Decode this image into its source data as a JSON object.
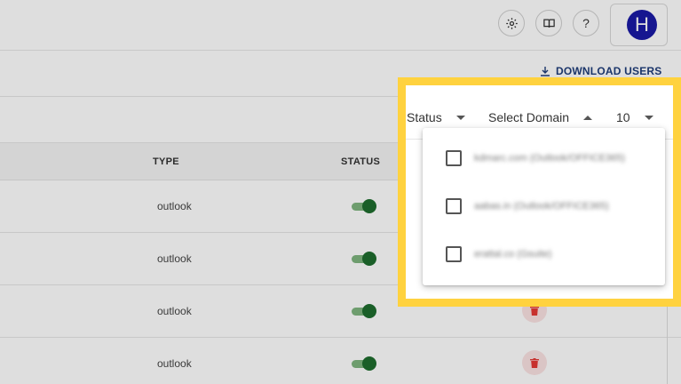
{
  "header": {
    "settings_icon": "gear-icon",
    "docs_icon": "book-icon",
    "help_label": "?",
    "avatar_initial": "H"
  },
  "toolbar": {
    "download_label": "DOWNLOAD USERS",
    "download_icon": "download-icon"
  },
  "filters": {
    "status_label": "Status",
    "domain_label": "Select Domain",
    "page_size": "10"
  },
  "table": {
    "columns": [
      "TYPE",
      "STATUS"
    ],
    "rows": [
      {
        "type": "outlook",
        "status": "on"
      },
      {
        "type": "outlook",
        "status": "on"
      },
      {
        "type": "outlook",
        "status": "on"
      },
      {
        "type": "outlook",
        "status": "on"
      }
    ]
  },
  "domain_dropdown": {
    "options": [
      {
        "label": "kdmarc.com (Outlook/OFFICE365)",
        "checked": false
      },
      {
        "label": "aabas.in (Outlook/OFFICE365)",
        "checked": false
      },
      {
        "label": "erattal.co (Gsuite)",
        "checked": false
      }
    ]
  },
  "colors": {
    "highlight": "#ffd23f",
    "avatar": "#1a1aa6",
    "toggle_on": "#1e6e2e",
    "delete_icon": "#e53935",
    "link": "#1f3d7a"
  }
}
